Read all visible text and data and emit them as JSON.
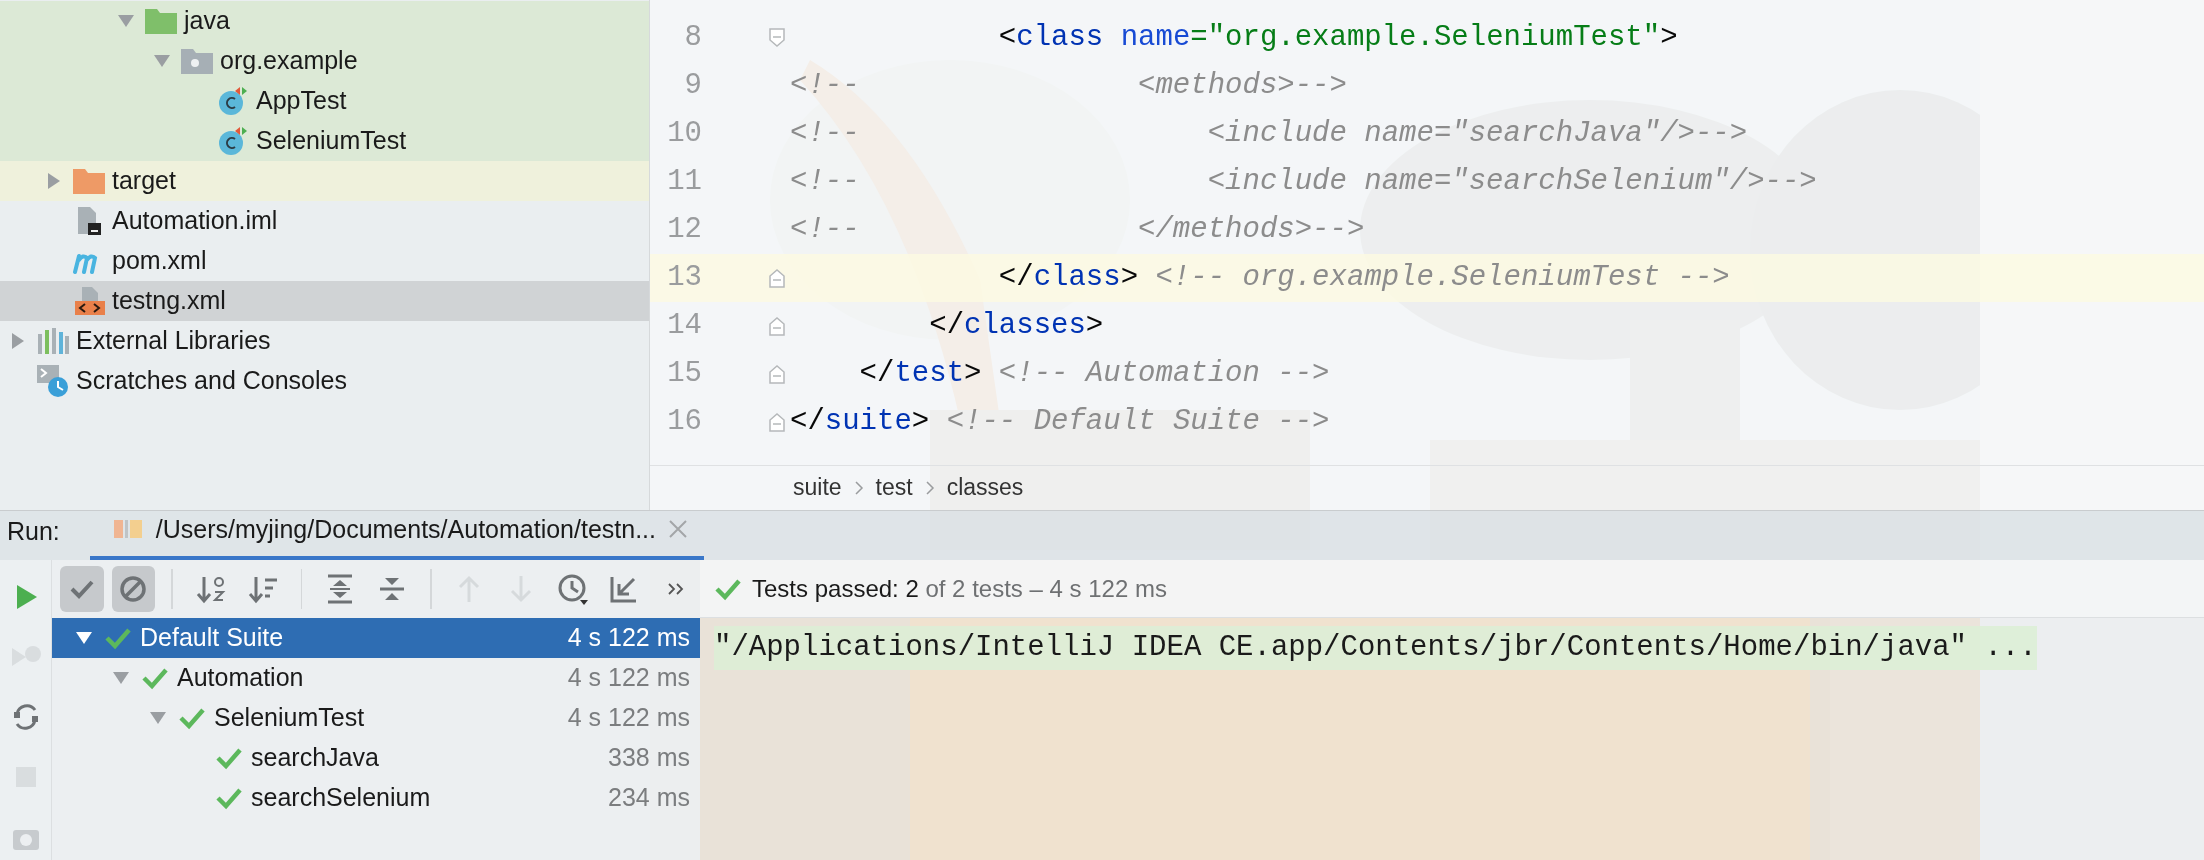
{
  "project_tree": {
    "clipped_branch": [
      {
        "name": "java",
        "kind": "source-folder",
        "expanded": true,
        "selected": false,
        "children": [
          {
            "name": "org.example",
            "kind": "package",
            "expanded": true,
            "selected": false,
            "children": [
              {
                "name": "AppTest",
                "kind": "test-class",
                "selected": false
              },
              {
                "name": "SeleniumTest",
                "kind": "test-class",
                "selected": false
              }
            ]
          }
        ]
      }
    ],
    "module_items": [
      {
        "name": "target",
        "kind": "excluded-folder",
        "expanded": false,
        "selected": false
      },
      {
        "name": "Automation.iml",
        "kind": "iml-file",
        "selected": false
      },
      {
        "name": "pom.xml",
        "kind": "maven-file",
        "selected": false
      },
      {
        "name": "testng.xml",
        "kind": "xml-file",
        "selected": true
      }
    ],
    "root_items": [
      {
        "name": "External Libraries",
        "kind": "libraries",
        "expanded": false,
        "selected": false
      },
      {
        "name": "Scratches and Consoles",
        "kind": "scratches",
        "selected": false
      }
    ]
  },
  "editor": {
    "lines": [
      {
        "number": "8",
        "kind": "fold-start",
        "current": false,
        "tokens": [
          {
            "kind": "punct",
            "text": "            <"
          },
          {
            "kind": "tag",
            "text": "class"
          },
          {
            "kind": "attr",
            "text": " name"
          },
          {
            "kind": "value",
            "text": "=\"org.example.SeleniumTest\""
          },
          {
            "kind": "punct",
            "text": ">"
          }
        ]
      },
      {
        "number": "9",
        "kind": "plain",
        "current": false,
        "tokens": [
          {
            "kind": "comment",
            "text": "<!--                <methods>-->"
          }
        ]
      },
      {
        "number": "10",
        "kind": "plain",
        "current": false,
        "tokens": [
          {
            "kind": "comment",
            "text": "<!--                    <include name=\"searchJava\"/>-->"
          }
        ]
      },
      {
        "number": "11",
        "kind": "plain",
        "current": false,
        "tokens": [
          {
            "kind": "comment",
            "text": "<!--                    <include name=\"searchSelenium\"/>-->"
          }
        ]
      },
      {
        "number": "12",
        "kind": "plain",
        "current": false,
        "tokens": [
          {
            "kind": "comment",
            "text": "<!--                </methods>-->"
          }
        ]
      },
      {
        "number": "13",
        "kind": "fold-end",
        "current": true,
        "tokens": [
          {
            "kind": "punct",
            "text": "            </"
          },
          {
            "kind": "tag",
            "text": "class"
          },
          {
            "kind": "punct",
            "text": "> "
          },
          {
            "kind": "comment",
            "text": "<!-- org.example.SeleniumTest -->"
          }
        ]
      },
      {
        "number": "14",
        "kind": "fold-end",
        "current": false,
        "tokens": [
          {
            "kind": "punct",
            "text": "        </"
          },
          {
            "kind": "tag",
            "text": "classes"
          },
          {
            "kind": "punct",
            "text": ">"
          }
        ]
      },
      {
        "number": "15",
        "kind": "fold-end",
        "current": false,
        "tokens": [
          {
            "kind": "punct",
            "text": "    </"
          },
          {
            "kind": "tag",
            "text": "test"
          },
          {
            "kind": "punct",
            "text": "> "
          },
          {
            "kind": "comment",
            "text": "<!-- Automation -->"
          }
        ]
      },
      {
        "number": "16",
        "kind": "fold-end",
        "current": false,
        "tokens": [
          {
            "kind": "punct",
            "text": "</"
          },
          {
            "kind": "tag",
            "text": "suite"
          },
          {
            "kind": "punct",
            "text": "> "
          },
          {
            "kind": "comment",
            "text": "<!-- Default Suite -->"
          }
        ]
      }
    ],
    "breadcrumbs": [
      "suite",
      "test",
      "classes"
    ]
  },
  "run_panel": {
    "label": "Run:",
    "tabs": [
      {
        "title": "/Users/myjing/Documents/Automation/testn...",
        "selected": true
      }
    ],
    "side_buttons": [
      {
        "kind": "run",
        "disabled": false
      },
      {
        "kind": "rerun-failed",
        "disabled": true
      },
      {
        "kind": "auto-rerun",
        "disabled": false
      },
      {
        "kind": "stop",
        "disabled": true
      },
      {
        "kind": "camera",
        "disabled": false
      }
    ],
    "toolbar_groups": [
      {
        "buttons": [
          {
            "kind": "show-passed",
            "pressed": true,
            "disabled": false
          },
          {
            "kind": "show-ignored",
            "pressed": true,
            "disabled": false
          }
        ]
      },
      {
        "buttons": [
          {
            "kind": "sort-alpha",
            "pressed": false,
            "disabled": false
          },
          {
            "kind": "sort-duration",
            "pressed": false,
            "disabled": false
          }
        ]
      },
      {
        "buttons": [
          {
            "kind": "expand-all",
            "pressed": false,
            "disabled": false
          },
          {
            "kind": "collapse-all",
            "pressed": false,
            "disabled": false
          }
        ]
      },
      {
        "buttons": [
          {
            "kind": "previous",
            "pressed": false,
            "disabled": true
          },
          {
            "kind": "next",
            "pressed": false,
            "disabled": true
          },
          {
            "kind": "history",
            "pressed": false,
            "disabled": false
          },
          {
            "kind": "import",
            "pressed": false,
            "disabled": false
          },
          {
            "kind": "more",
            "pressed": false,
            "disabled": false
          }
        ]
      }
    ],
    "status": {
      "passed": true,
      "summary": "Tests passed: 2",
      "detail": "of 2 tests – 4 s 122 ms"
    },
    "tests": [
      {
        "name": "Default Suite",
        "duration": "4 s 122 ms",
        "passed": true,
        "expanded": true,
        "selected": true,
        "children": [
          {
            "name": "Automation",
            "duration": "4 s 122 ms",
            "passed": true,
            "expanded": true,
            "selected": false,
            "children": [
              {
                "name": "SeleniumTest",
                "duration": "4 s 122 ms",
                "passed": true,
                "expanded": true,
                "selected": false,
                "children": [
                  {
                    "name": "searchJava",
                    "duration": "338 ms",
                    "passed": true,
                    "selected": false
                  },
                  {
                    "name": "searchSelenium",
                    "duration": "234 ms",
                    "passed": true,
                    "selected": false
                  }
                ]
              }
            ]
          }
        ]
      }
    ],
    "console_lines": [
      {
        "text": "\"/Applications/IntelliJ IDEA CE.app/Contents/jbr/Contents/Home/bin/java\" ...",
        "highlighted": true
      }
    ]
  }
}
